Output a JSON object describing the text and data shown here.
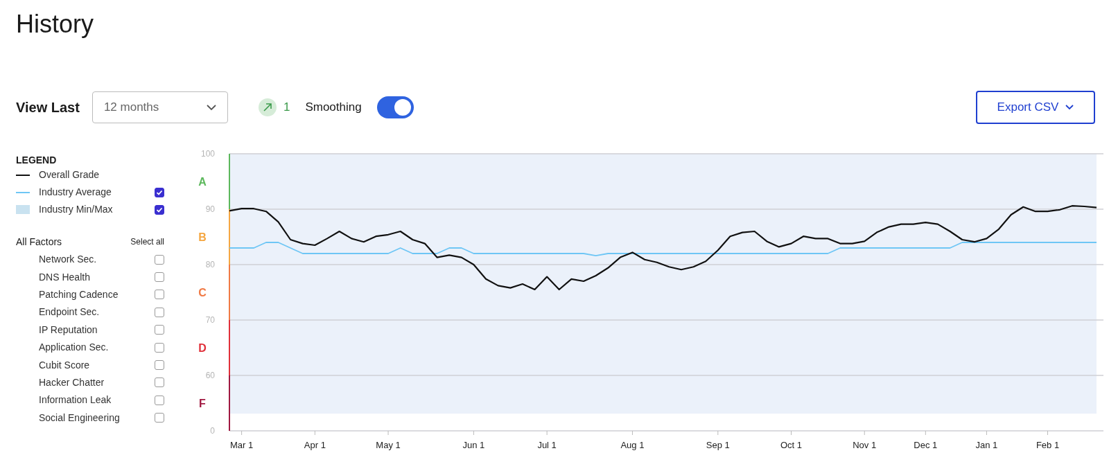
{
  "title": "History",
  "view_last": {
    "label": "View Last",
    "value": "12 months"
  },
  "trend": {
    "value": "1"
  },
  "smoothing": {
    "label": "Smoothing",
    "on": true
  },
  "export": {
    "label": "Export CSV"
  },
  "legend": {
    "title": "LEGEND",
    "items": [
      {
        "label": "Overall Grade",
        "kind": "line",
        "color": "#111111"
      },
      {
        "label": "Industry Average",
        "kind": "line",
        "color": "#6ec6f5",
        "checked": true
      },
      {
        "label": "Industry Min/Max",
        "kind": "band",
        "color": "#c9e2f0",
        "checked": true
      }
    ]
  },
  "factors": {
    "title": "All Factors",
    "select_all": "Select all",
    "items": [
      {
        "label": "Network Sec.",
        "checked": false
      },
      {
        "label": "DNS Health",
        "checked": false
      },
      {
        "label": "Patching Cadence",
        "checked": false
      },
      {
        "label": "Endpoint Sec.",
        "checked": false
      },
      {
        "label": "IP Reputation",
        "checked": false
      },
      {
        "label": "Application Sec.",
        "checked": false
      },
      {
        "label": "Cubit Score",
        "checked": false
      },
      {
        "label": "Hacker Chatter",
        "checked": false
      },
      {
        "label": "Information Leak",
        "checked": false
      },
      {
        "label": "Social Engineering",
        "checked": false
      }
    ]
  },
  "axis_floor_label": "0",
  "grades": [
    {
      "label": "A",
      "color": "#5cb85c"
    },
    {
      "label": "B",
      "color": "#f5a742"
    },
    {
      "label": "C",
      "color": "#f07a45"
    },
    {
      "label": "D",
      "color": "#e0303a"
    },
    {
      "label": "F",
      "color": "#a01840"
    }
  ],
  "chart_data": {
    "type": "line",
    "categories": [
      null,
      "Mar 1",
      null,
      null,
      null,
      null,
      null,
      "Apr 1",
      null,
      null,
      null,
      null,
      null,
      "May 1",
      null,
      null,
      null,
      null,
      null,
      null,
      "Jun 1",
      null,
      null,
      null,
      null,
      null,
      "Jul 1",
      null,
      null,
      null,
      null,
      null,
      null,
      "Aug 1",
      null,
      null,
      null,
      null,
      null,
      null,
      "Sep 1",
      null,
      null,
      null,
      null,
      null,
      "Oct 1",
      null,
      null,
      null,
      null,
      null,
      "Nov 1",
      null,
      null,
      null,
      null,
      "Dec 1",
      null,
      null,
      null,
      null,
      "Jan 1",
      null,
      null,
      null,
      null,
      "Feb 1",
      null,
      null,
      null,
      null
    ],
    "ylim": [
      50,
      100
    ],
    "grid": true,
    "yticks": [
      60,
      70,
      80,
      90,
      100
    ],
    "series": [
      {
        "color": "#111111",
        "values": [
          89.7,
          90.1,
          90.1,
          89.6,
          87.7,
          84.5,
          83.8,
          83.5,
          84.7,
          86,
          84.7,
          84.1,
          85.1,
          85.4,
          86,
          84.5,
          83.8,
          81.3,
          81.7,
          81.3,
          80,
          77.4,
          76.2,
          75.8,
          76.5,
          75.5,
          77.8,
          75.5,
          77.4,
          77,
          78,
          79.4,
          81.3,
          82.2,
          80.9,
          80.4,
          79.6,
          79.1,
          79.6,
          80.6,
          82.6,
          85.1,
          85.8,
          86,
          84.2,
          83.2,
          83.8,
          85.1,
          84.7,
          84.7,
          83.8,
          83.8,
          84.2,
          85.8,
          86.8,
          87.3,
          87.3,
          87.6,
          87.3,
          86,
          84.5,
          84.1,
          84.7,
          86.4,
          89,
          90.4,
          89.6,
          89.6,
          89.9,
          90.6,
          90.5,
          90.3
        ]
      },
      {
        "color": "#6ec6f5",
        "values": [
          83,
          83,
          83,
          84,
          84,
          83,
          82,
          82,
          82,
          82,
          82,
          82,
          82,
          82,
          83,
          82,
          82,
          82,
          83,
          83,
          82,
          82,
          82,
          82,
          82,
          82,
          82,
          82,
          82,
          82,
          81.6,
          82,
          82,
          82,
          82,
          82,
          82,
          82,
          82,
          82,
          82,
          82,
          82,
          82,
          82,
          82,
          82,
          82,
          82,
          82,
          83,
          83,
          83,
          83,
          83,
          83,
          83,
          83,
          83,
          83,
          84,
          84,
          84,
          84,
          84,
          84,
          84,
          84,
          84,
          84,
          84,
          84
        ]
      }
    ]
  }
}
